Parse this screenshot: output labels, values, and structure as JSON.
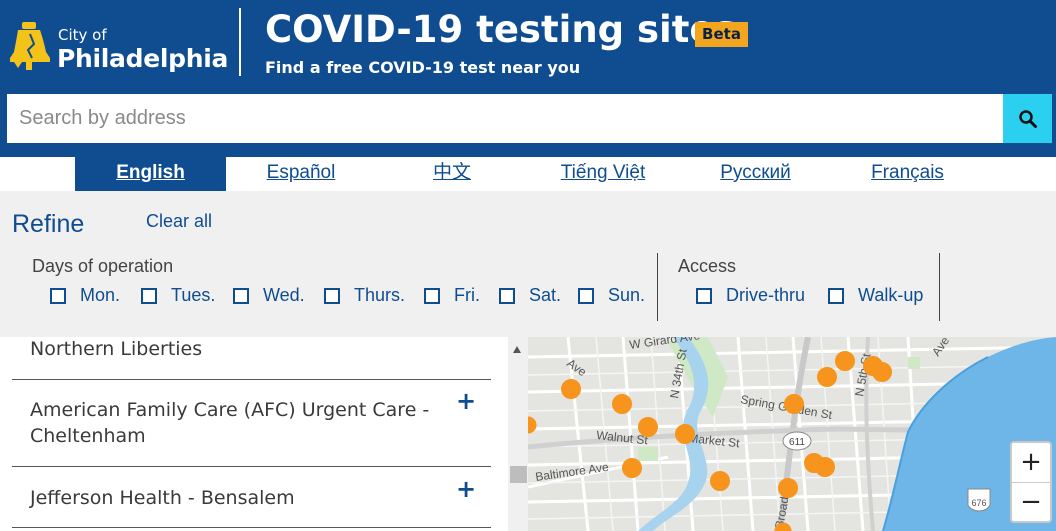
{
  "header": {
    "logo_city": "City of",
    "logo_name": "Philadelphia",
    "title": "COVID-19 testing sites",
    "beta": "Beta",
    "subtitle": "Find a free COVID-19 test near you"
  },
  "search": {
    "placeholder": "Search by address"
  },
  "languages": [
    {
      "label": "English",
      "active": true
    },
    {
      "label": "Español"
    },
    {
      "label": "中文"
    },
    {
      "label": "Tiếng Việt"
    },
    {
      "label": "Русский"
    },
    {
      "label": "Français"
    }
  ],
  "refine": {
    "title": "Refine",
    "clear_all": "Clear all",
    "days_label": "Days of operation",
    "days": [
      "Mon.",
      "Tues.",
      "Wed.",
      "Thurs.",
      "Fri.",
      "Sat.",
      "Sun."
    ],
    "access_label": "Access",
    "access": [
      "Drive-thru",
      "Walk-up"
    ]
  },
  "list": {
    "items": [
      {
        "name": "Northern Liberties"
      },
      {
        "name_line1": "American Family Care (AFC) Urgent Care -",
        "name_line2": "Cheltenham",
        "expand": "+"
      },
      {
        "name": "Jefferson Health - Bensalem",
        "expand": "+"
      }
    ]
  },
  "map": {
    "labels": [
      "W Girard Ave",
      "N 34th St",
      "Spring Garden St",
      "N 5th St",
      "Walnut St",
      "Market St",
      "Baltimore Ave",
      "611",
      "676",
      "Broad",
      "Ave",
      "Ave"
    ],
    "zoom_in": "+",
    "zoom_out": "−",
    "marker_color": "#f7941d"
  }
}
